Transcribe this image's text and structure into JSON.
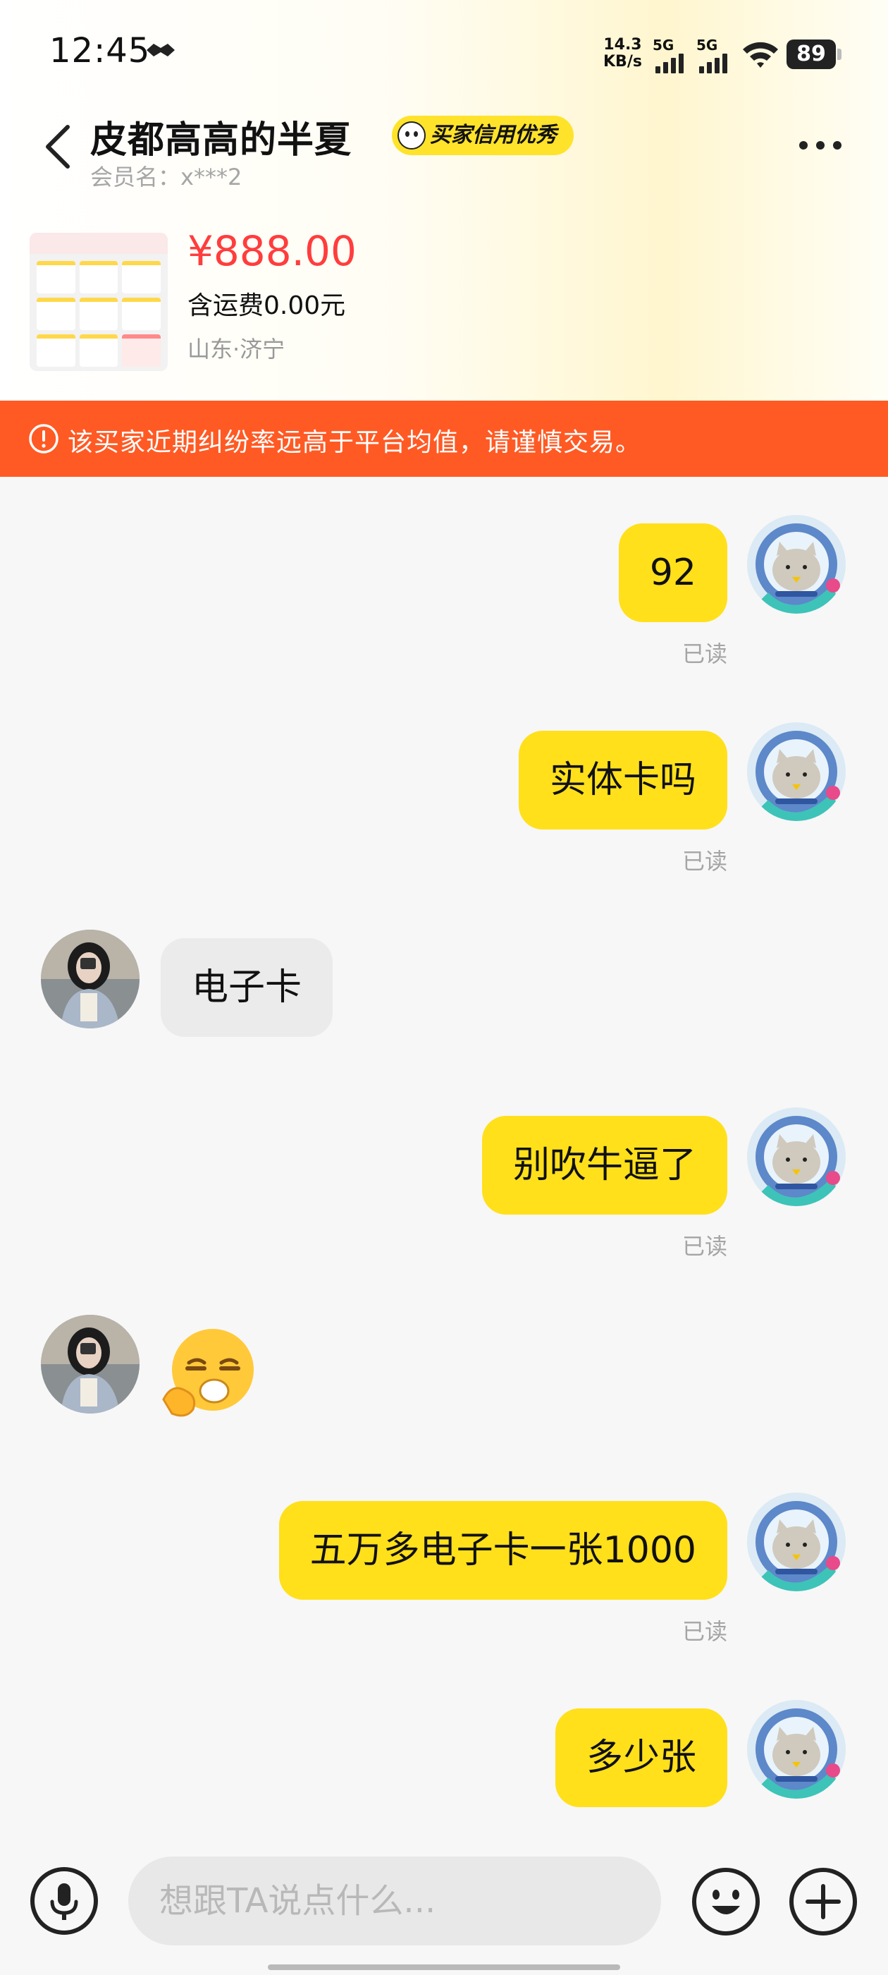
{
  "status_bar": {
    "time": "12:45",
    "speed_value": "14.3",
    "speed_unit": "KB/s",
    "signal1_label": "5G",
    "signal2_label": "5G",
    "battery": "89"
  },
  "header": {
    "title": "皮都高高的半夏",
    "credit_badge": "买家信用优秀",
    "member_name": "会员名：x***2"
  },
  "product": {
    "price": "¥888.00",
    "shipping": "含运费0.00元",
    "location": "山东·济宁"
  },
  "warning": {
    "text": "该买家近期纠纷率远高于平台均值，请谨慎交易。"
  },
  "messages": [
    {
      "from": "me",
      "text": "92",
      "status": "已读"
    },
    {
      "from": "me",
      "text": "实体卡吗",
      "status": "已读"
    },
    {
      "from": "them",
      "text": "电子卡"
    },
    {
      "from": "me",
      "text": "别吹牛逼了",
      "status": "已读"
    },
    {
      "from": "them",
      "emoji": "smirk-emoji"
    },
    {
      "from": "me",
      "text": "五万多电子卡一张1000",
      "status": "已读"
    },
    {
      "from": "me",
      "text": "多少张"
    }
  ],
  "composer": {
    "placeholder": "想跟TA说点什么..."
  },
  "colors": {
    "accent_yellow": "#ffe01b",
    "warning_orange": "#ff5a24",
    "price_red": "#ff3d3d"
  }
}
